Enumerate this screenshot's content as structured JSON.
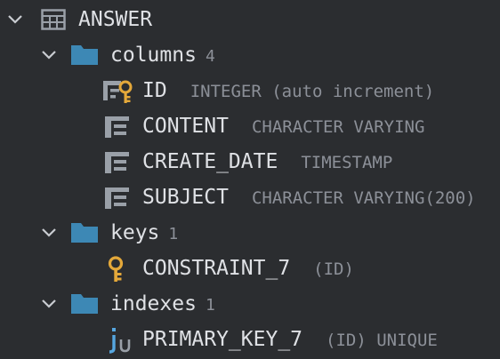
{
  "table": {
    "name": "ANSWER",
    "expanded": true,
    "icon": "table-icon"
  },
  "columns_folder": {
    "label": "columns",
    "count": "4",
    "expanded": true,
    "icon": "folder-icon"
  },
  "columns": [
    {
      "name": "ID",
      "type": "INTEGER (auto increment)",
      "icon": "primary-key-column-icon"
    },
    {
      "name": "CONTENT",
      "type": "CHARACTER VARYING",
      "icon": "column-icon"
    },
    {
      "name": "CREATE_DATE",
      "type": "TIMESTAMP",
      "icon": "column-icon"
    },
    {
      "name": "SUBJECT",
      "type": "CHARACTER VARYING(200)",
      "icon": "column-icon"
    }
  ],
  "keys_folder": {
    "label": "keys",
    "count": "1",
    "expanded": true,
    "icon": "folder-icon"
  },
  "keys": [
    {
      "name": "CONSTRAINT_7",
      "detail": "(ID)",
      "icon": "key-icon"
    }
  ],
  "indexes_folder": {
    "label": "indexes",
    "count": "1",
    "expanded": true,
    "icon": "folder-icon"
  },
  "indexes": [
    {
      "name": "PRIMARY_KEY_7",
      "detail": "(ID) UNIQUE",
      "icon": "unique-index-icon"
    }
  ],
  "colors": {
    "background": "#2b2d30",
    "text": "#dfe1e5",
    "muted_text": "#8c9098",
    "folder": "#3d88b5",
    "key": "#e4a83a",
    "index": "#56a7e0",
    "table_icon": "#9aa0a8"
  }
}
